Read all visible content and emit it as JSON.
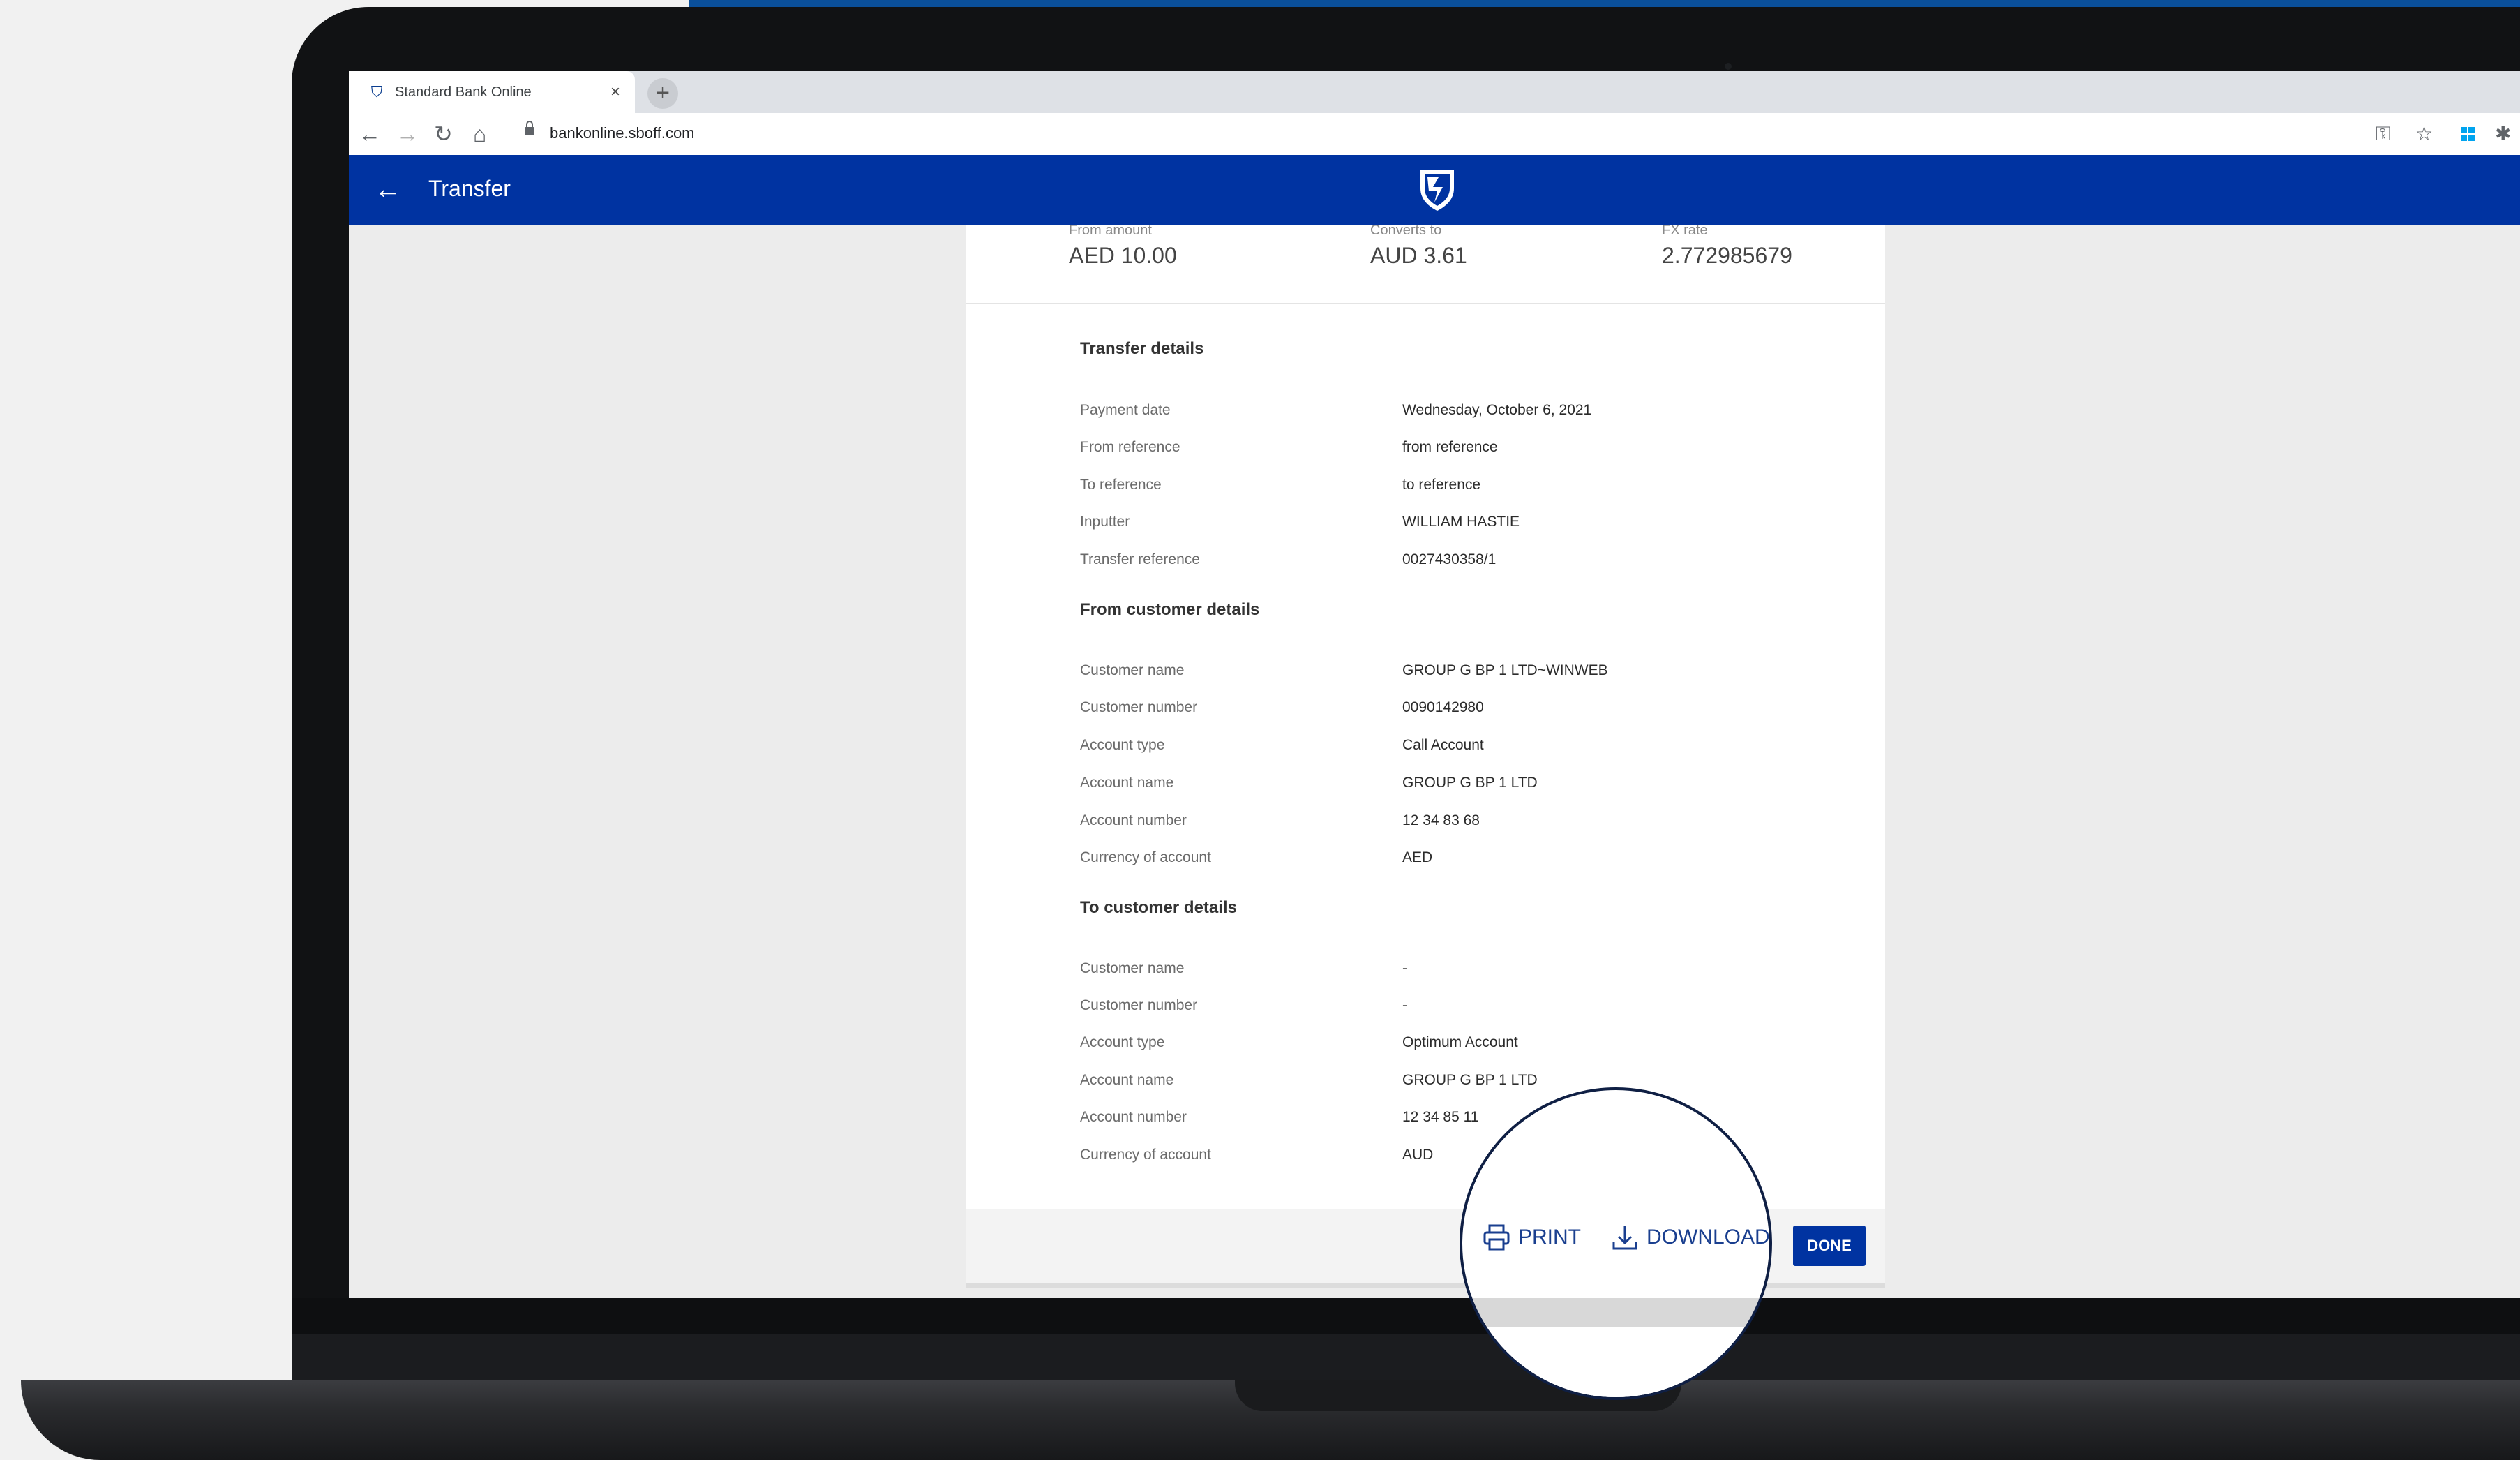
{
  "browser": {
    "tab_title": "Standard Bank Online",
    "tab_close": "×",
    "new_tab": "+",
    "url": "bankonline.sboff.com",
    "back": "←",
    "forward": "→",
    "reload": "↻",
    "home": "⌂",
    "key_icon": "⚿",
    "star_icon": "☆",
    "ext_icon": "✱",
    "minimize": "—"
  },
  "appbar": {
    "back": "←",
    "title": "Transfer"
  },
  "fx": [
    {
      "label": "From amount",
      "value": "AED 10.00"
    },
    {
      "label": "Converts to",
      "value": "AUD 3.61"
    },
    {
      "label": "FX rate",
      "value": "2.772985679"
    }
  ],
  "transfer_details": {
    "title": "Transfer details",
    "rows": [
      {
        "label": "Payment date",
        "value": "Wednesday, October 6, 2021"
      },
      {
        "label": "From reference",
        "value": "from reference"
      },
      {
        "label": "To reference",
        "value": "to reference"
      },
      {
        "label": "Inputter",
        "value": "WILLIAM HASTIE"
      },
      {
        "label": "Transfer reference",
        "value": "0027430358/1"
      }
    ]
  },
  "from_customer": {
    "title": "From customer details",
    "rows": [
      {
        "label": "Customer name",
        "value": "GROUP G BP 1 LTD~WINWEB"
      },
      {
        "label": "Customer number",
        "value": "0090142980"
      },
      {
        "label": "Account type",
        "value": "Call Account"
      },
      {
        "label": "Account name",
        "value": "GROUP G BP 1 LTD"
      },
      {
        "label": "Account number",
        "value": "12 34 83 68"
      },
      {
        "label": "Currency of account",
        "value": "AED"
      }
    ]
  },
  "to_customer": {
    "title": "To customer details",
    "rows": [
      {
        "label": "Customer name",
        "value": "-"
      },
      {
        "label": "Customer number",
        "value": "-"
      },
      {
        "label": "Account type",
        "value": "Optimum Account"
      },
      {
        "label": "Account name",
        "value": "GROUP G BP 1 LTD"
      },
      {
        "label": "Account number",
        "value": "12 34 85 11"
      },
      {
        "label": "Currency of account",
        "value": "AUD"
      }
    ]
  },
  "actions": {
    "print": "PRINT",
    "download": "DOWNLOAD",
    "done": "DONE"
  },
  "colors": {
    "brand_blue": "#0033a1",
    "action_blue": "#1a3f8f"
  }
}
